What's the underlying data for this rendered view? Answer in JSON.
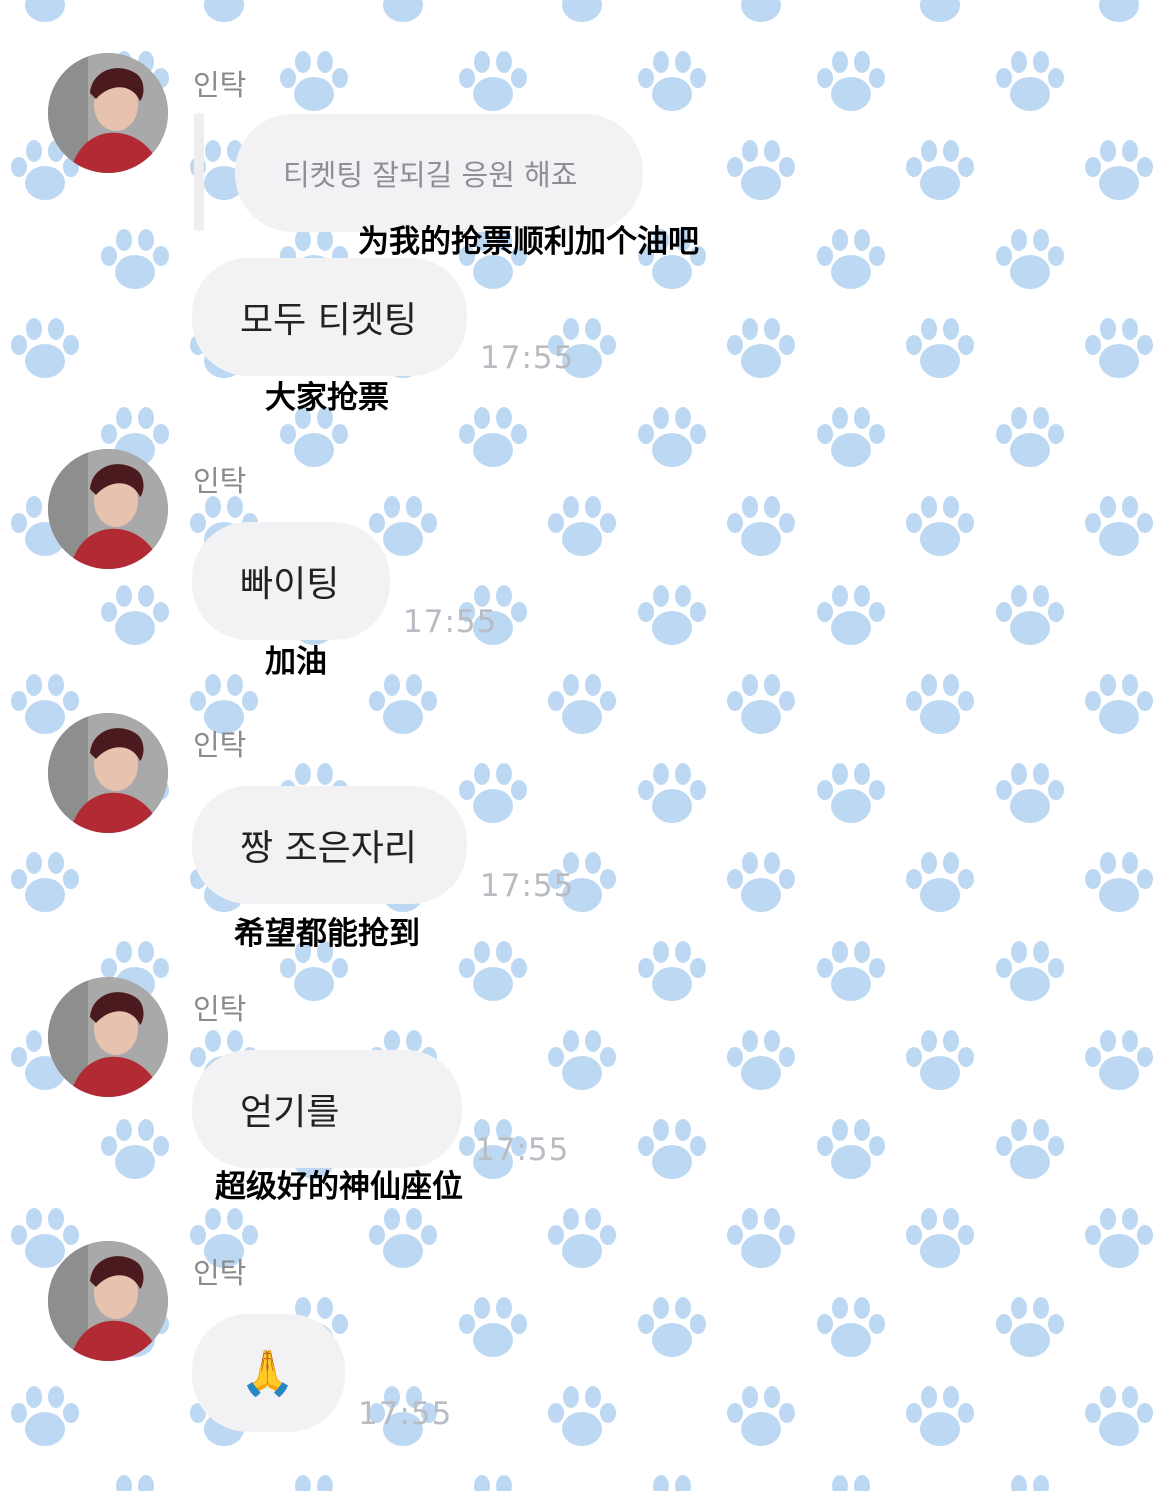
{
  "colors": {
    "background": "#ffffff",
    "paw": "#bcd8f2",
    "bubble": "#f2f2f4",
    "time": "#b9bcc2",
    "sender": "#8a8a8a",
    "caption": "#000000"
  },
  "reply": {
    "quoted_text": "티켓팅 잘되길 응원 해죠",
    "caption": "为我的抢票顺利加个油吧"
  },
  "messages": [
    {
      "sender": "인탁",
      "text": "모두 티켓팅",
      "time": "17:55",
      "caption": "大家抢票"
    },
    {
      "sender": "인탁",
      "text": "빠이팅",
      "time": "17:55",
      "caption": "加油"
    },
    {
      "sender": "인탁",
      "text": "짱 조은자리",
      "time": "17:55",
      "caption": "希望都能抢到"
    },
    {
      "sender": "인탁",
      "text": "얻기를",
      "time": "17:55",
      "caption": "超级好的神仙座位"
    },
    {
      "sender": "인탁",
      "text": "🙏",
      "time": "17:55",
      "caption": ""
    }
  ],
  "first_sender": "인탁",
  "avatar_icon": "user-avatar-photo",
  "emoji_icon": "folded-hands-icon"
}
